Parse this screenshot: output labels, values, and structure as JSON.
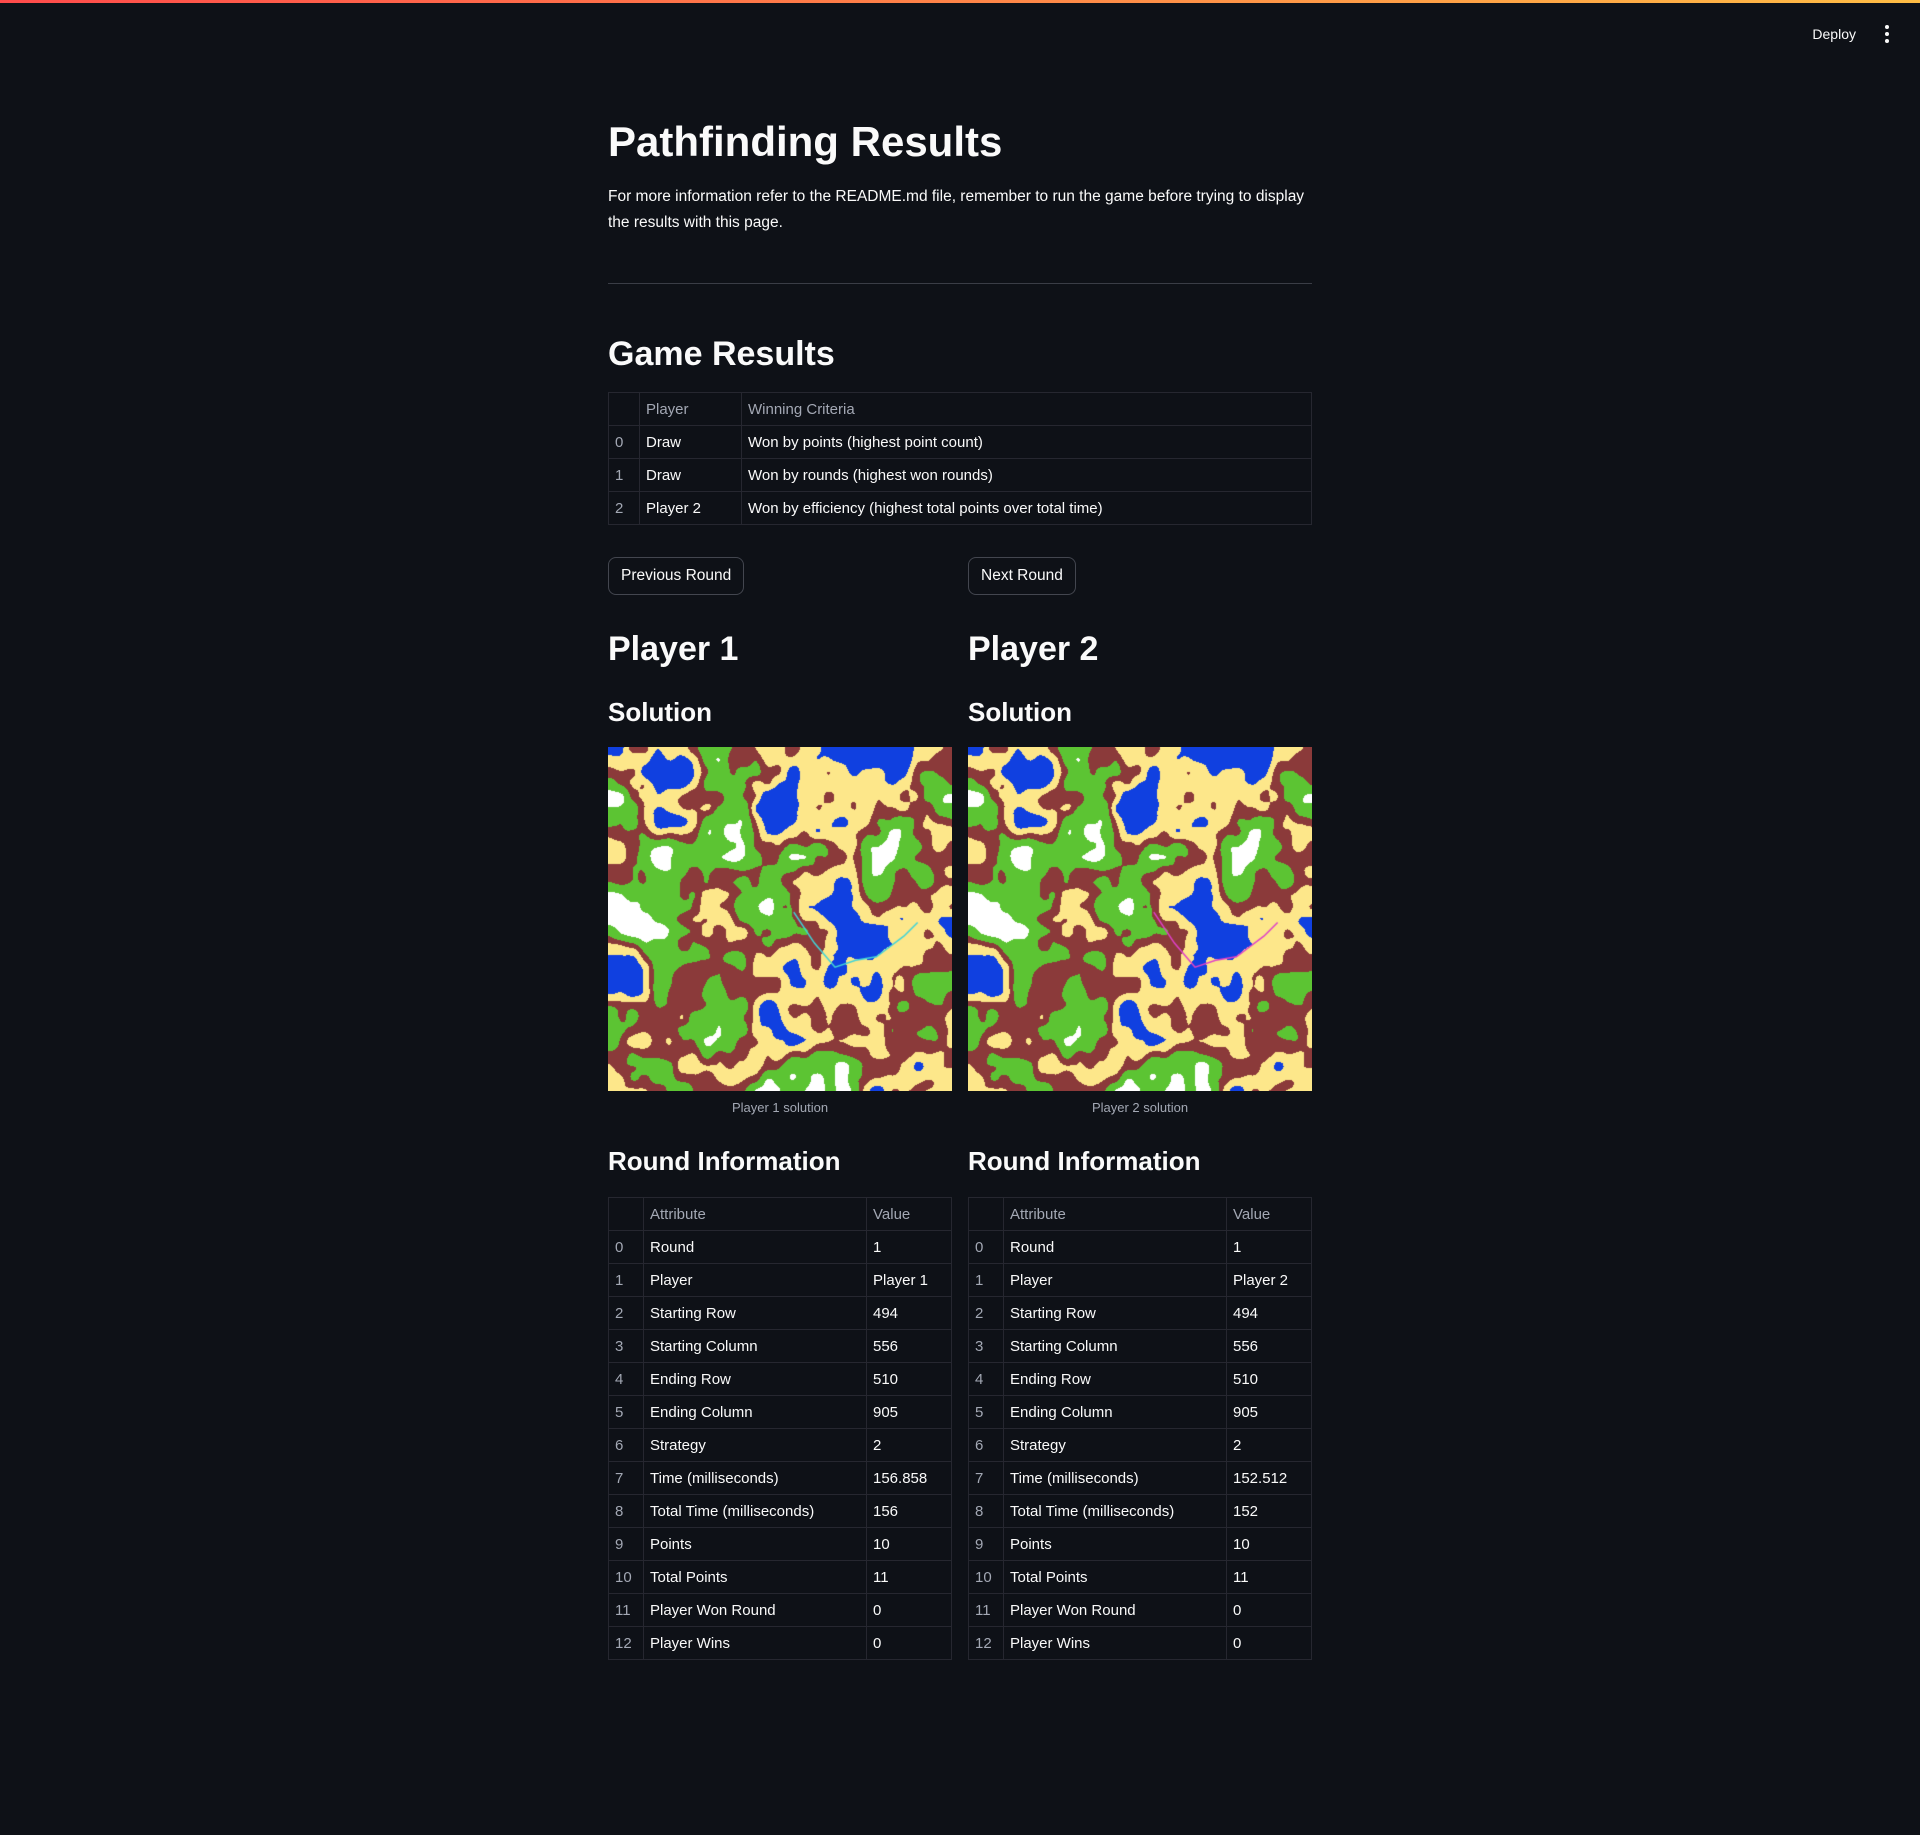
{
  "header": {
    "deploy_label": "Deploy",
    "menu_icon": "vertical-ellipsis-icon"
  },
  "page": {
    "title": "Pathfinding Results",
    "intro": "For more information refer to the README.md file, remember to run the game before trying to display the results with this page."
  },
  "game_results": {
    "heading": "Game Results",
    "columns": [
      "",
      "Player",
      "Winning Criteria"
    ],
    "rows": [
      {
        "index": "0",
        "player": "Draw",
        "criteria": "Won by points (highest point count)"
      },
      {
        "index": "1",
        "player": "Draw",
        "criteria": "Won by rounds (highest won rounds)"
      },
      {
        "index": "2",
        "player": "Player 2",
        "criteria": "Won by efficiency (highest total points over total time)"
      }
    ]
  },
  "nav": {
    "previous_label": "Previous Round",
    "next_label": "Next Round"
  },
  "players": [
    {
      "name": "Player 1",
      "solution_heading": "Solution",
      "caption": "Player 1 solution",
      "path_color": "#3fd4d8",
      "round_heading": "Round Information",
      "columns": [
        "",
        "Attribute",
        "Value"
      ],
      "rows": [
        {
          "index": "0",
          "attribute": "Round",
          "value": "1"
        },
        {
          "index": "1",
          "attribute": "Player",
          "value": "Player 1"
        },
        {
          "index": "2",
          "attribute": "Starting Row",
          "value": "494"
        },
        {
          "index": "3",
          "attribute": "Starting Column",
          "value": "556"
        },
        {
          "index": "4",
          "attribute": "Ending Row",
          "value": "510"
        },
        {
          "index": "5",
          "attribute": "Ending Column",
          "value": "905"
        },
        {
          "index": "6",
          "attribute": "Strategy",
          "value": "2"
        },
        {
          "index": "7",
          "attribute": "Time (milliseconds)",
          "value": "156.858"
        },
        {
          "index": "8",
          "attribute": "Total Time (milliseconds)",
          "value": "156"
        },
        {
          "index": "9",
          "attribute": "Points",
          "value": "10"
        },
        {
          "index": "10",
          "attribute": "Total Points",
          "value": "11"
        },
        {
          "index": "11",
          "attribute": "Player Won Round",
          "value": "0"
        },
        {
          "index": "12",
          "attribute": "Player Wins",
          "value": "0"
        }
      ]
    },
    {
      "name": "Player 2",
      "solution_heading": "Solution",
      "caption": "Player 2 solution",
      "path_color": "#e040c8",
      "round_heading": "Round Information",
      "columns": [
        "",
        "Attribute",
        "Value"
      ],
      "rows": [
        {
          "index": "0",
          "attribute": "Round",
          "value": "1"
        },
        {
          "index": "1",
          "attribute": "Player",
          "value": "Player 2"
        },
        {
          "index": "2",
          "attribute": "Starting Row",
          "value": "494"
        },
        {
          "index": "3",
          "attribute": "Starting Column",
          "value": "556"
        },
        {
          "index": "4",
          "attribute": "Ending Row",
          "value": "510"
        },
        {
          "index": "5",
          "attribute": "Ending Column",
          "value": "905"
        },
        {
          "index": "6",
          "attribute": "Strategy",
          "value": "2"
        },
        {
          "index": "7",
          "attribute": "Time (milliseconds)",
          "value": "152.512"
        },
        {
          "index": "8",
          "attribute": "Total Time (milliseconds)",
          "value": "152"
        },
        {
          "index": "9",
          "attribute": "Points",
          "value": "10"
        },
        {
          "index": "10",
          "attribute": "Total Points",
          "value": "11"
        },
        {
          "index": "11",
          "attribute": "Player Won Round",
          "value": "0"
        },
        {
          "index": "12",
          "attribute": "Player Wins",
          "value": "0"
        }
      ]
    }
  ],
  "map_colors": {
    "water": "#1040e0",
    "sand": "#fde78a",
    "dirt": "#8b3a3a",
    "grass": "#5cc433",
    "snow": "#ffffff"
  }
}
